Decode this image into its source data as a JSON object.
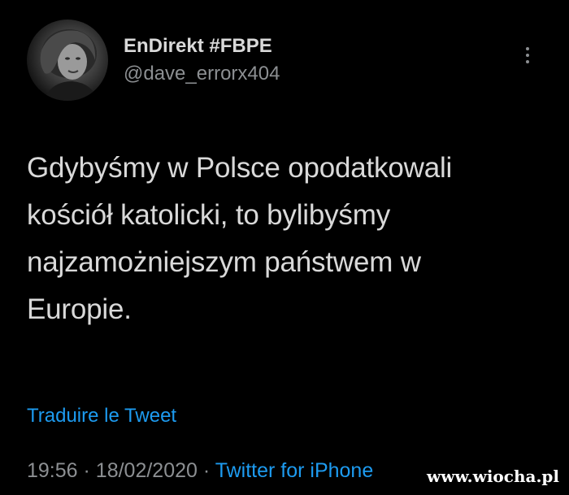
{
  "user": {
    "display_name": "EnDirekt #FBPE",
    "handle": "@dave_errorx404"
  },
  "tweet": {
    "lines": [
      "Gdybyśmy w Polsce opodatkowali",
      "kościół katolicki, to bylibyśmy",
      "najzamożniejszym państwem w",
      "Europie."
    ],
    "translate_label": "Traduire le Tweet",
    "time": "19:56",
    "separator": "·",
    "date": "18/02/2020",
    "source": "Twitter for iPhone"
  },
  "watermark": "www.wiocha.pl",
  "icons": {
    "avatar": "profile-photo",
    "more": "more-options-icon"
  },
  "colors": {
    "background": "#000000",
    "text": "#d9d9d9",
    "secondary": "#8c8f92",
    "link": "#1d9bf0"
  }
}
